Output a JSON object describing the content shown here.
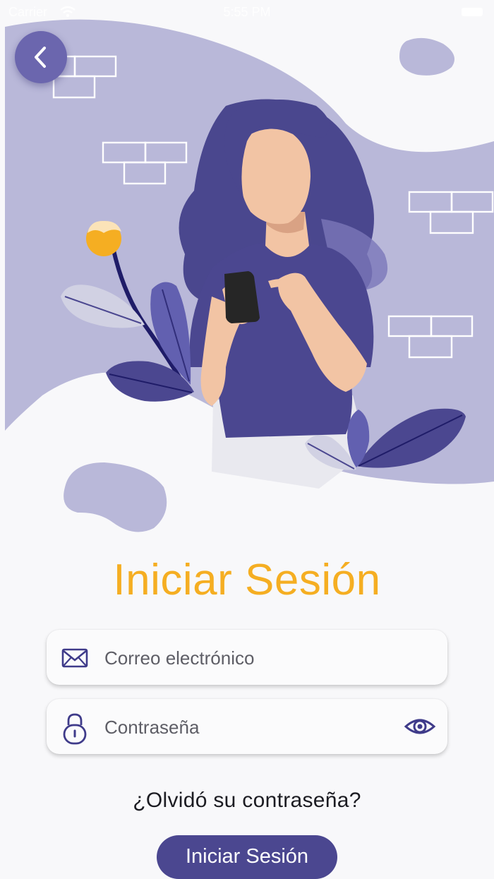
{
  "status_bar": {
    "carrier": "Carrier",
    "time": "5:55 PM"
  },
  "header": {
    "back_icon": "chevron-left-icon"
  },
  "login": {
    "title": "Iniciar Sesión",
    "email": {
      "placeholder": "Correo electrónico",
      "icon": "mail-icon"
    },
    "password": {
      "placeholder": "Contraseña",
      "icon": "lock-icon",
      "toggle_icon": "eye-icon"
    },
    "forgot_label": "¿Olvidó su contraseña?",
    "submit_label": "Iniciar Sesión"
  },
  "colors": {
    "accent": "#f5ae22",
    "primary": "#4b4790",
    "illustration_bg": "#b9b8d9",
    "skin": "#f2c4a4"
  }
}
